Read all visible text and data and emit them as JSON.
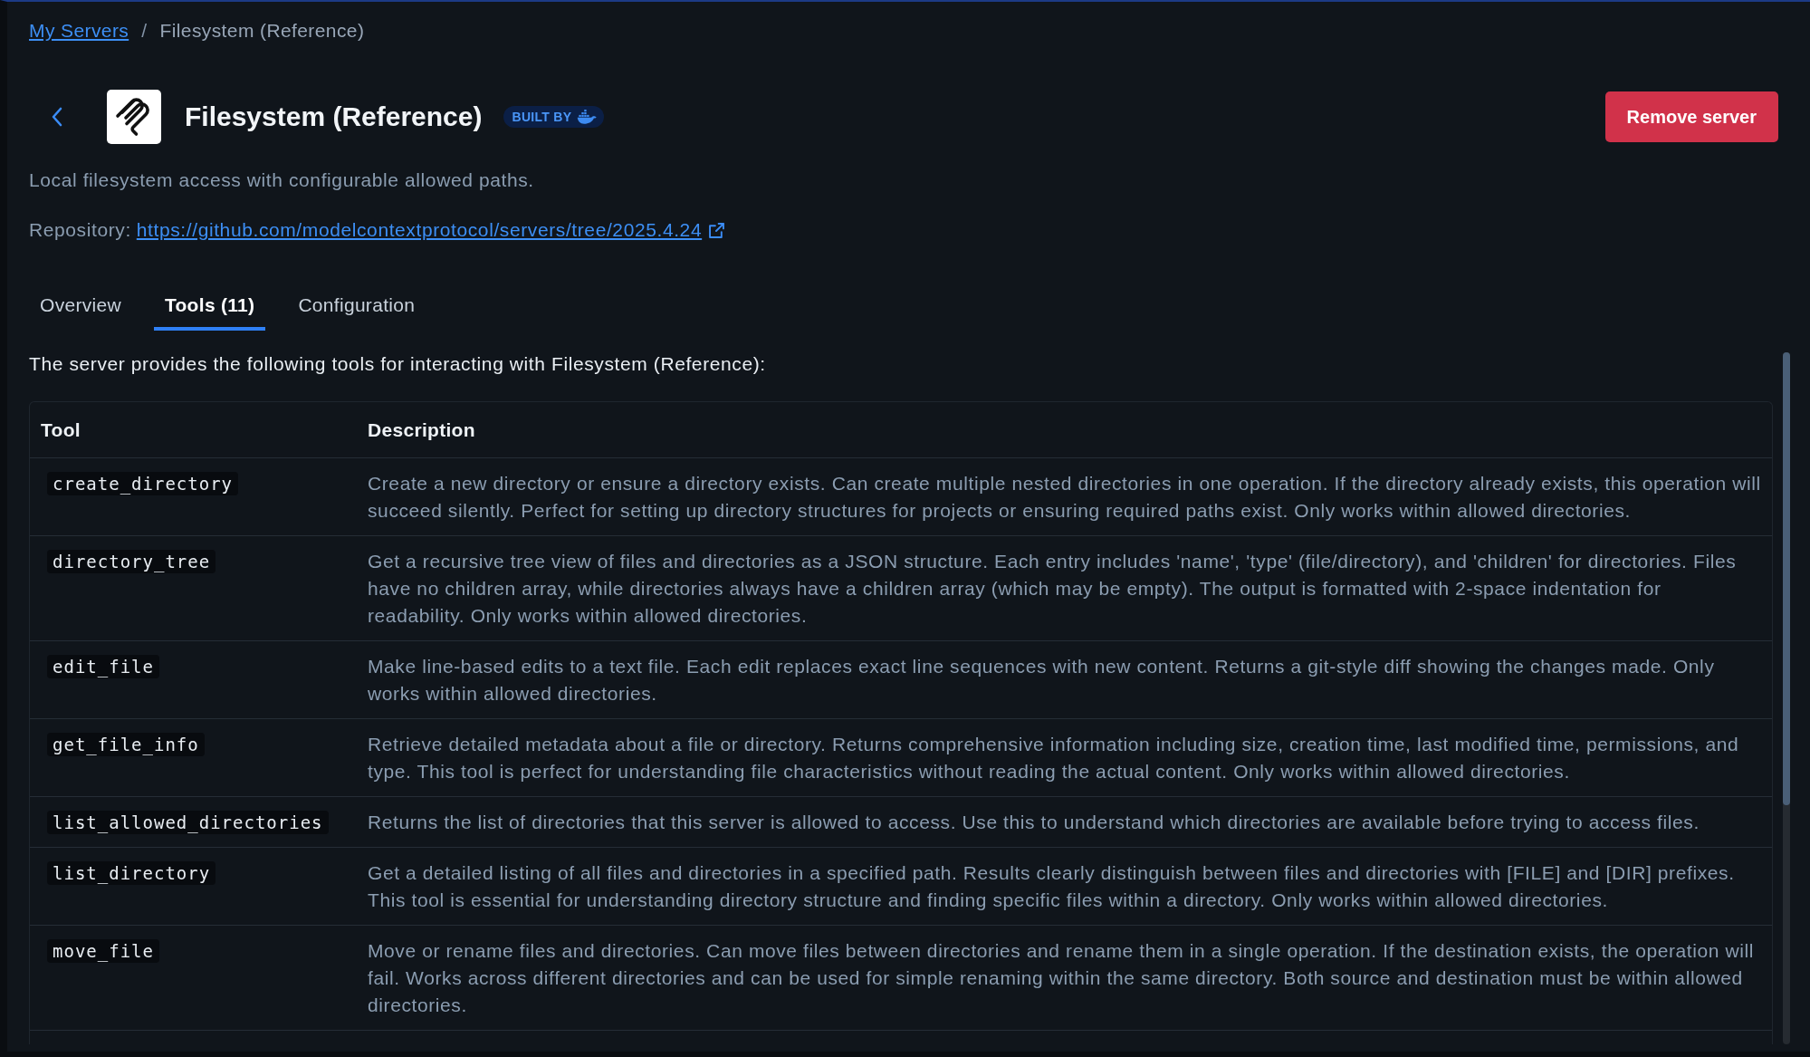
{
  "breadcrumb": {
    "items": [
      {
        "label": "My Servers",
        "kind": "link"
      },
      {
        "label": "Filesystem (Reference)",
        "kind": "current"
      }
    ],
    "separator": "/"
  },
  "server": {
    "name": "Filesystem (Reference)",
    "badge": "BUILT BY",
    "description": "Local filesystem access with configurable allowed paths.",
    "repository_label": "Repository:",
    "repository_url": "https://github.com/modelcontextprotocol/servers/tree/2025.4.24"
  },
  "remove_button": "Remove server",
  "tabs": [
    {
      "label": "Overview",
      "selected": false
    },
    {
      "label": "Tools (11)",
      "selected": true
    },
    {
      "label": "Configuration",
      "selected": false
    }
  ],
  "intro": "The server provides the following tools for interacting with Filesystem (Reference):",
  "table": {
    "columns": [
      "Tool",
      "Description"
    ],
    "rows": [
      {
        "tool": "create_directory",
        "description": "Create a new directory or ensure a directory exists. Can create multiple nested directories in one operation. If the directory already exists, this operation will succeed silently. Perfect for setting up directory structures for projects or ensuring required paths exist. Only works within allowed directories."
      },
      {
        "tool": "directory_tree",
        "description": "Get a recursive tree view of files and directories as a JSON structure. Each entry includes 'name', 'type' (file/directory), and 'children' for directories. Files have no children array, while directories always have a children array (which may be empty). The output is formatted with 2-space indentation for readability. Only works within allowed directories."
      },
      {
        "tool": "edit_file",
        "description": "Make line-based edits to a text file. Each edit replaces exact line sequences with new content. Returns a git-style diff showing the changes made. Only works within allowed directories."
      },
      {
        "tool": "get_file_info",
        "description": "Retrieve detailed metadata about a file or directory. Returns comprehensive information including size, creation time, last modified time, permissions, and type. This tool is perfect for understanding file characteristics without reading the actual content. Only works within allowed directories."
      },
      {
        "tool": "list_allowed_directories",
        "description": "Returns the list of directories that this server is allowed to access. Use this to understand which directories are available before trying to access files."
      },
      {
        "tool": "list_directory",
        "description": "Get a detailed listing of all files and directories in a specified path. Results clearly distinguish between files and directories with [FILE] and [DIR] prefixes. This tool is essential for understanding directory structure and finding specific files within a directory. Only works within allowed directories."
      },
      {
        "tool": "move_file",
        "description": "Move or rename files and directories. Can move files between directories and rename them in a single operation. If the destination exists, the operation will fail. Works across different directories and can be used for simple renaming within the same directory. Both source and destination must be within allowed directories."
      }
    ]
  }
}
